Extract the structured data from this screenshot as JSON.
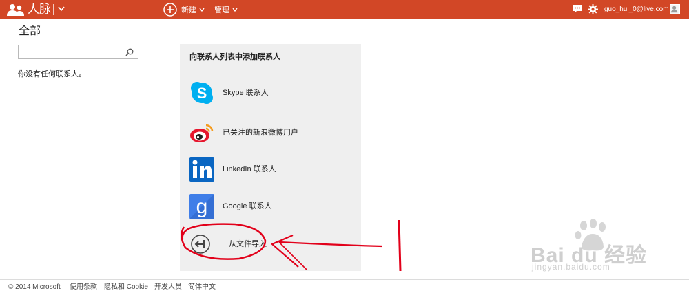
{
  "topbar": {
    "app_title": "人脉",
    "new_label": "新建",
    "manage_label": "管理",
    "user_email": "guo_hui_0@live.com",
    "accent_color": "#d24726"
  },
  "left": {
    "all_label": "全部",
    "search": {
      "value": "",
      "placeholder": ""
    },
    "empty_text": "你没有任何联系人。"
  },
  "panel": {
    "title": "向联系人列表中添加联系人",
    "sources": [
      {
        "label": "Skype 联系人",
        "icon": "skype-icon"
      },
      {
        "label": "已关注的新浪微博用户",
        "icon": "weibo-icon"
      },
      {
        "label": "LinkedIn 联系人",
        "icon": "linkedin-icon"
      },
      {
        "label": "Google 联系人",
        "icon": "google-icon"
      },
      {
        "label": "从文件导入",
        "icon": "import-icon"
      }
    ]
  },
  "footer": {
    "copyright": "© 2014 Microsoft",
    "terms": "使用条款",
    "privacy": "隐私和 Cookie",
    "developers": "开发人员",
    "language": "简体中文"
  },
  "watermark": {
    "text": "Bai du 经验",
    "url": "jingyan.baidu.com"
  }
}
